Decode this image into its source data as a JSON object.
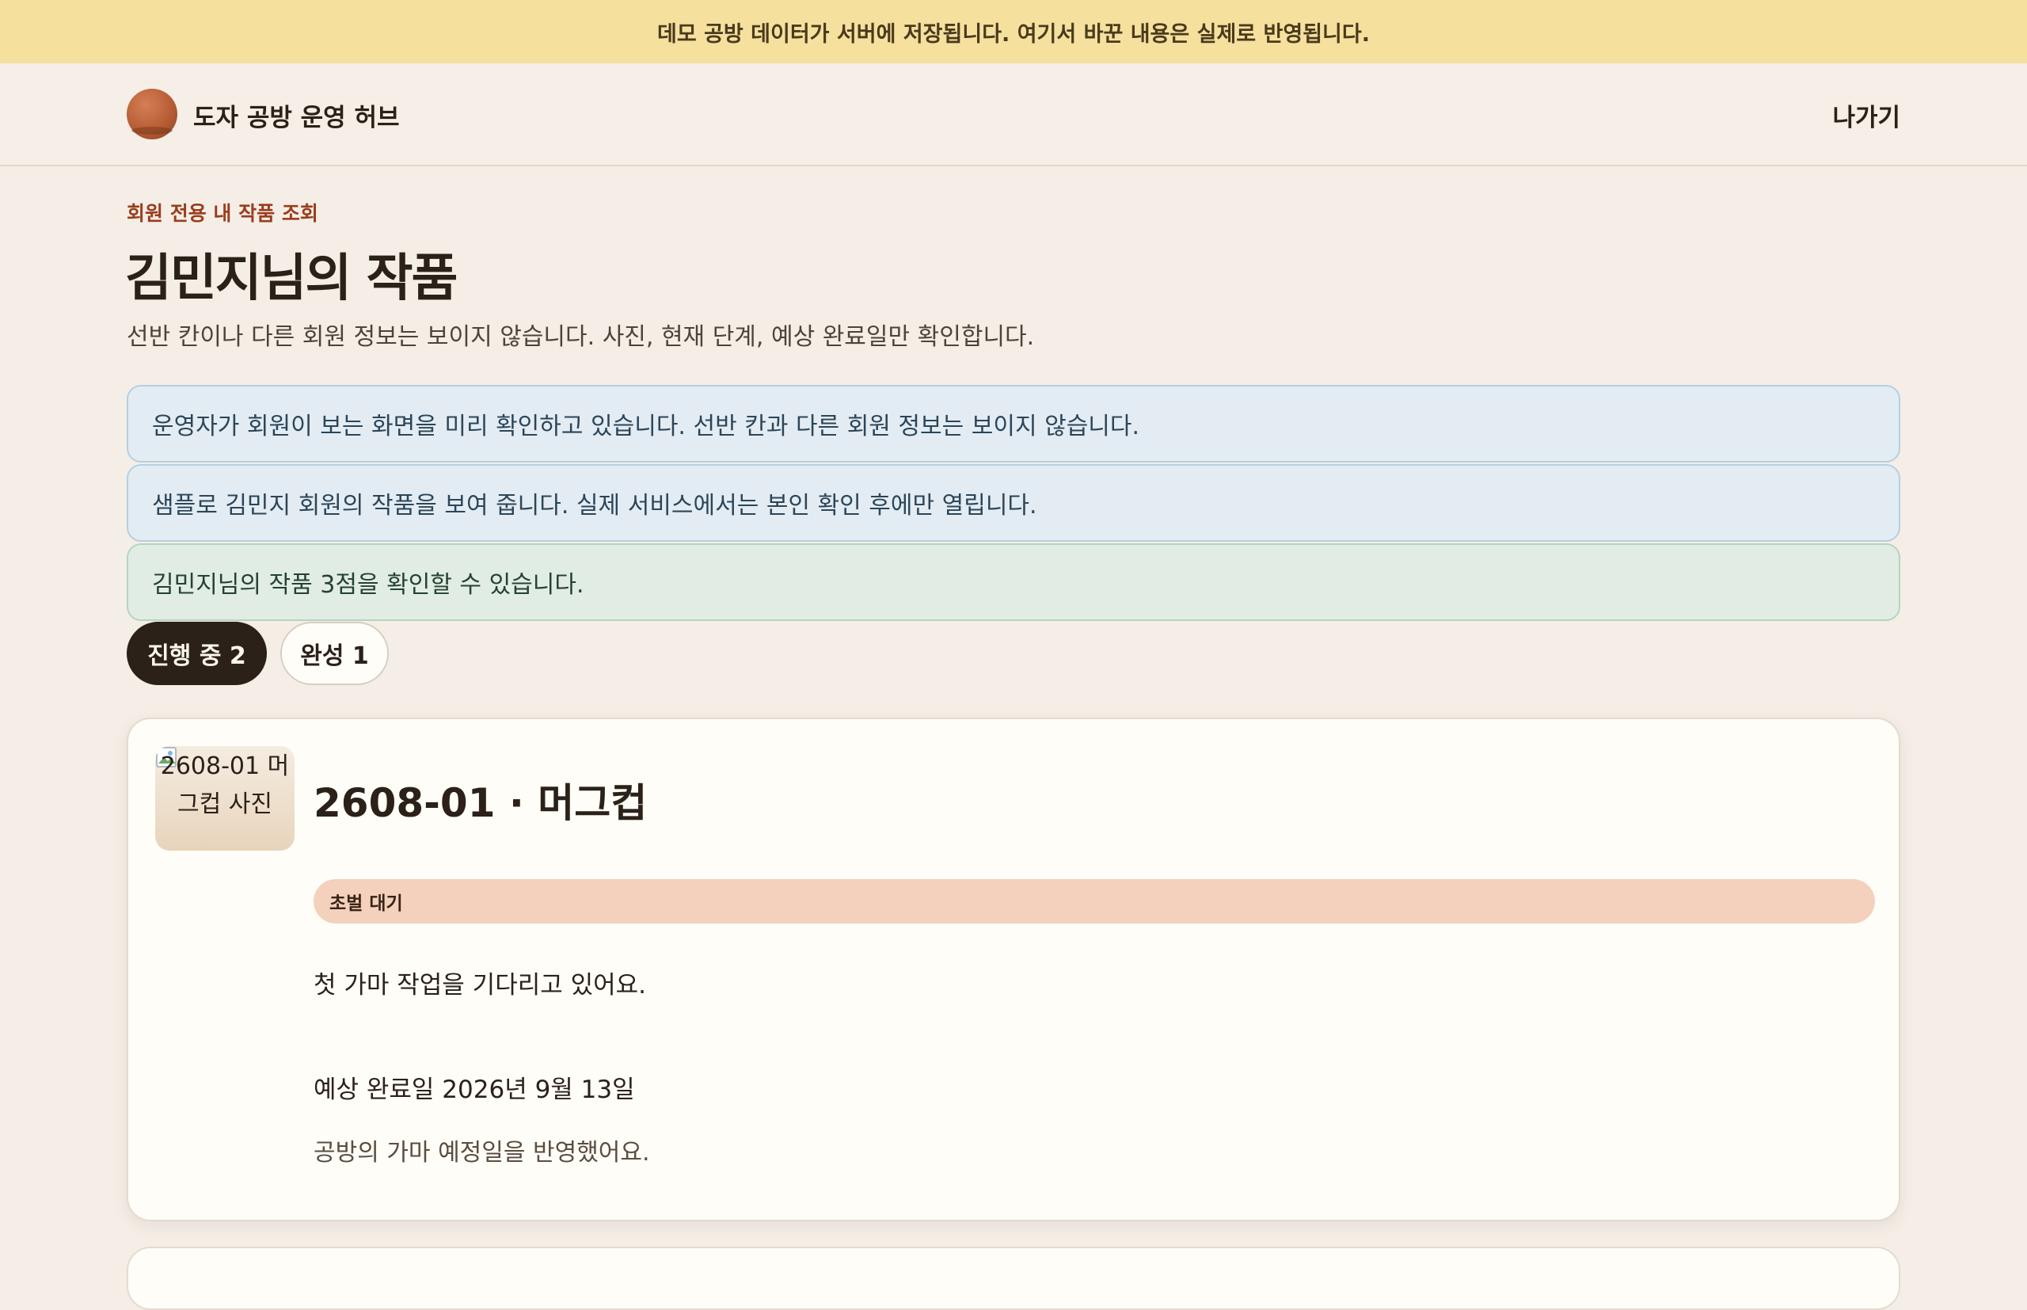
{
  "banner": {
    "text": "데모 공방 데이터가 서버에 저장됩니다. 여기서 바꾼 내용은 실제로 반영됩니다."
  },
  "header": {
    "app_title": "도자 공방 운영 허브",
    "exit_label": "나가기"
  },
  "page": {
    "eyebrow": "회원 전용 내 작품 조회",
    "title": "김민지님의 작품",
    "description": "선반 칸이나 다른 회원 정보는 보이지 않습니다. 사진, 현재 단계, 예상 완료일만 확인합니다."
  },
  "notices": [
    {
      "type": "info",
      "text": "운영자가 회원이 보는 화면을 미리 확인하고 있습니다. 선반 칸과 다른 회원 정보는 보이지 않습니다."
    },
    {
      "type": "info",
      "text": "샘플로 김민지 회원의 작품을 보여 줍니다. 실제 서비스에서는 본인 확인 후에만 열립니다."
    },
    {
      "type": "success",
      "text": "김민지님의 작품 3점을 확인할 수 있습니다."
    }
  ],
  "tabs": [
    {
      "label": "진행 중 2",
      "active": true
    },
    {
      "label": "완성 1",
      "active": false
    }
  ],
  "works": [
    {
      "photo_alt": "2608-01 머그컵 사진",
      "title": "2608-01 · 머그컵",
      "stage": "초벌 대기",
      "message": "첫 가마 작업을 기다리고 있어요.",
      "eta": "예상 완료일 2026년 9월 13일",
      "note": "공방의 가마 예정일을 반영했어요."
    }
  ],
  "colors": {
    "banner_bg": "#f5e09e",
    "accent": "#9a3d1d",
    "info_bg": "#e3ecf3",
    "success_bg": "#e1ede4",
    "stage_badge_bg": "#f3d1bc",
    "active_tab_bg": "#2b2118"
  },
  "icons": {
    "logo": "clay-pot-icon",
    "photo_placeholder": "broken-image-icon"
  }
}
